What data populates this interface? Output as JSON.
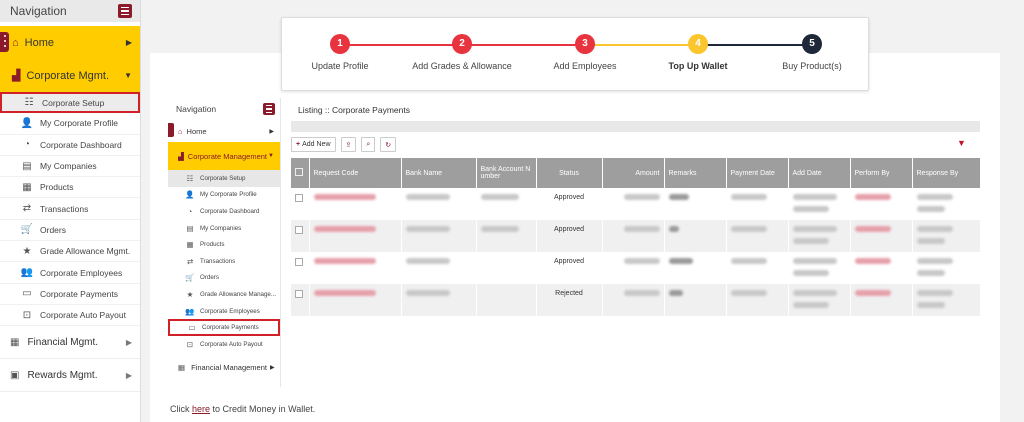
{
  "nav": {
    "title": "Navigation",
    "home": "Home",
    "corporate": "Corporate Mgmt.",
    "items": [
      {
        "label": "Corporate Setup",
        "icon": "list-icon",
        "glyph": "☷",
        "active": true
      },
      {
        "label": "My Corporate Profile",
        "icon": "user-icon",
        "glyph": "👤"
      },
      {
        "label": "Corporate Dashboard",
        "icon": "dashboard-icon",
        "glyph": "◔"
      },
      {
        "label": "My Companies",
        "icon": "document-icon",
        "glyph": "▤"
      },
      {
        "label": "Products",
        "icon": "box-icon",
        "glyph": "▦"
      },
      {
        "label": "Transactions",
        "icon": "arrows-icon",
        "glyph": "⇄"
      },
      {
        "label": "Orders",
        "icon": "cart-icon",
        "glyph": "🛒"
      },
      {
        "label": "Grade Allowance Mgmt.",
        "icon": "star-icon",
        "glyph": "★"
      },
      {
        "label": "Corporate Employees",
        "icon": "users-icon",
        "glyph": "👥"
      },
      {
        "label": "Corporate Payments",
        "icon": "card-icon",
        "glyph": "▭"
      },
      {
        "label": "Corporate Auto Payout",
        "icon": "cash-icon",
        "glyph": "⊡"
      }
    ],
    "financial": "Financial Mgmt.",
    "rewards": "Rewards Mgmt."
  },
  "stepper": {
    "steps": [
      {
        "num": "1",
        "label": "Update Profile",
        "color": "#e8343e"
      },
      {
        "num": "2",
        "label": "Add Grades & Allowance",
        "color": "#e8343e"
      },
      {
        "num": "3",
        "label": "Add Employees",
        "color": "#e8343e"
      },
      {
        "num": "4",
        "label": "Top Up Wallet",
        "color": "#fbc52d"
      },
      {
        "num": "5",
        "label": "Buy Product(s)",
        "color": "#1f2838"
      }
    ]
  },
  "inner_nav": {
    "title": "Navigation",
    "home": "Home",
    "corporate": "Corporate Management",
    "items": [
      {
        "label": "Corporate Setup",
        "icon": "list-icon",
        "glyph": "☷"
      },
      {
        "label": "My Corporate Profile",
        "icon": "user-icon",
        "glyph": "👤"
      },
      {
        "label": "Corporate Dashboard",
        "icon": "dashboard-icon",
        "glyph": "◔"
      },
      {
        "label": "My Companies",
        "icon": "document-icon",
        "glyph": "▤"
      },
      {
        "label": "Products",
        "icon": "box-icon",
        "glyph": "▦"
      },
      {
        "label": "Transactions",
        "icon": "arrows-icon",
        "glyph": "⇄"
      },
      {
        "label": "Orders",
        "icon": "cart-icon",
        "glyph": "🛒"
      },
      {
        "label": "Grade Allowance Manage...",
        "icon": "star-icon",
        "glyph": "★"
      },
      {
        "label": "Corporate Employees",
        "icon": "users-icon",
        "glyph": "👥"
      },
      {
        "label": "Corporate Payments",
        "icon": "card-icon",
        "glyph": "▭"
      },
      {
        "label": "Corporate Auto Payout",
        "icon": "cash-icon",
        "glyph": "⊡"
      }
    ],
    "financial": "Financial Management"
  },
  "listing": {
    "title": "Listing :: Corporate Payments",
    "add_new": "Add New",
    "columns": [
      "Request Code",
      "Bank Name",
      "Bank Account N umber",
      "Status",
      "Amount",
      "Remarks",
      "Payment Date",
      "Add Date",
      "Perform By",
      "Response By"
    ],
    "rows": [
      {
        "status": "Approved"
      },
      {
        "status": "Approved"
      },
      {
        "status": "Approved"
      },
      {
        "status": "Rejected"
      }
    ]
  },
  "footer": {
    "prefix": "Click",
    "link": "here",
    "suffix": "to Credit Money in Wallet."
  },
  "colors": {
    "brand": "#8b1a2b",
    "accent": "#ffcc00",
    "highlight": "#d12028"
  }
}
